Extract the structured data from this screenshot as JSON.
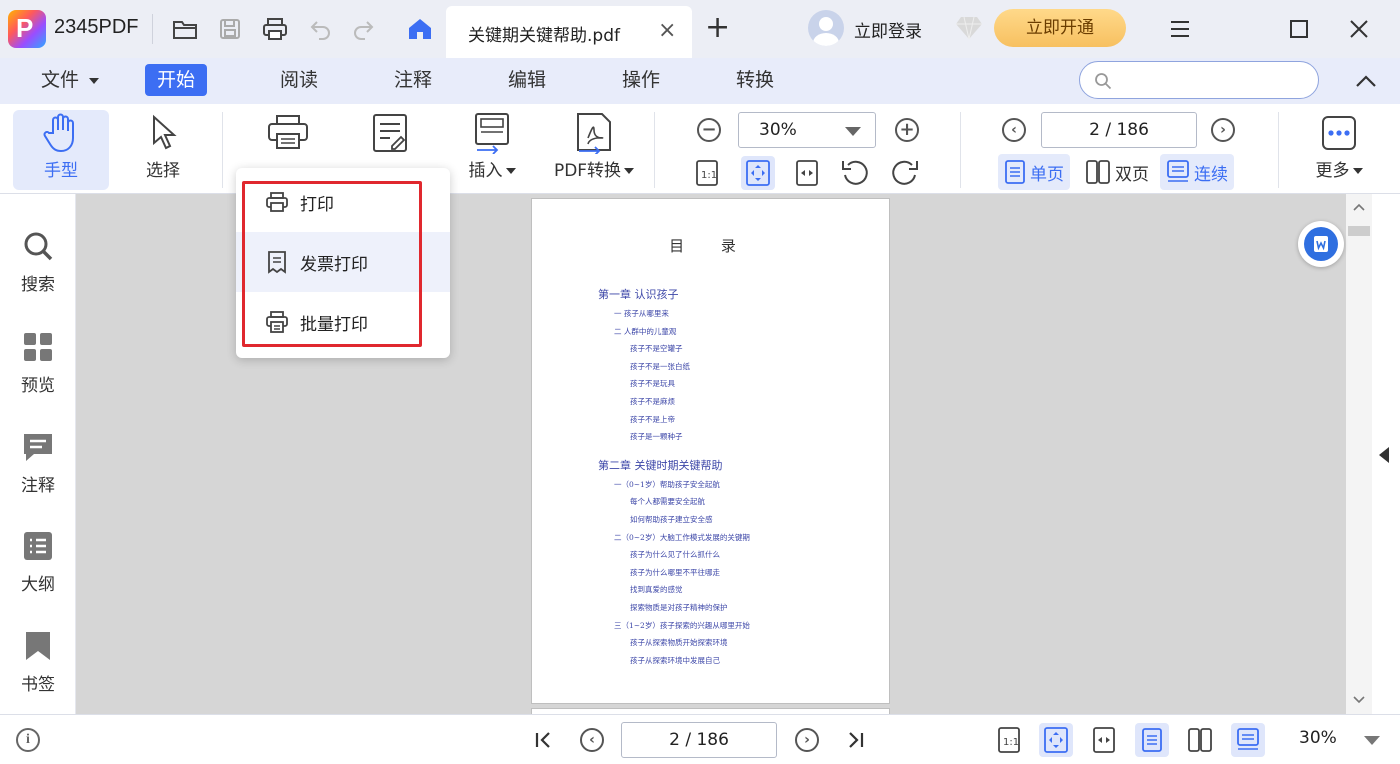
{
  "app": {
    "name": "2345PDF"
  },
  "tab": {
    "title": "关键期关键帮助.pdf",
    "close": "×",
    "add": "+"
  },
  "account": {
    "login_label": "立即登录",
    "vip_label": "立即开通"
  },
  "menu": {
    "items": [
      {
        "label": "文件",
        "has_caret": true
      },
      {
        "label": "开始",
        "active": true
      },
      {
        "label": "阅读"
      },
      {
        "label": "注释"
      },
      {
        "label": "编辑"
      },
      {
        "label": "操作"
      },
      {
        "label": "转换"
      }
    ]
  },
  "toolbar": {
    "hand_label": "手型",
    "select_label": "选择",
    "insert_label": "插入",
    "pdf_convert_label": "PDF转换",
    "zoom_value": "30%",
    "page_value": "2 / 186",
    "view_single": "单页",
    "view_double": "双页",
    "view_continuous": "连续",
    "more_label": "更多"
  },
  "print_menu": {
    "items": [
      {
        "label": "打印",
        "icon": "printer-icon"
      },
      {
        "label": "发票打印",
        "icon": "receipt-icon"
      },
      {
        "label": "批量打印",
        "icon": "batch-printer-icon"
      }
    ]
  },
  "sidebar": {
    "items": [
      {
        "label": "搜索",
        "icon": "search-icon"
      },
      {
        "label": "预览",
        "icon": "grid-icon"
      },
      {
        "label": "注释",
        "icon": "comment-icon"
      },
      {
        "label": "大纲",
        "icon": "outline-icon"
      },
      {
        "label": "书签",
        "icon": "bookmark-icon"
      }
    ]
  },
  "document": {
    "toc_title": "目 录",
    "toc": [
      {
        "level": "ch",
        "text": "第一章 认识孩子"
      },
      {
        "level": "l1",
        "text": "一 孩子从哪里来"
      },
      {
        "level": "l1",
        "text": "二 人群中的儿童观"
      },
      {
        "level": "l2",
        "text": "孩子不是空罐子"
      },
      {
        "level": "l2",
        "text": "孩子不是一张白纸"
      },
      {
        "level": "l2",
        "text": "孩子不是玩具"
      },
      {
        "level": "l2",
        "text": "孩子不是麻烦"
      },
      {
        "level": "l2",
        "text": "孩子不是上帝"
      },
      {
        "level": "l2",
        "text": "孩子是一颗种子"
      },
      {
        "level": "ch",
        "text": "第二章 关键时期关键帮助"
      },
      {
        "level": "l1",
        "text": "一（0~1岁）帮助孩子安全起航"
      },
      {
        "level": "l2",
        "text": "每个人都需要安全起航"
      },
      {
        "level": "l2",
        "text": "如何帮助孩子建立安全感"
      },
      {
        "level": "l1",
        "text": "二（0~2岁）大脑工作模式发展的关键期"
      },
      {
        "level": "l2",
        "text": "孩子为什么见了什么抓什么"
      },
      {
        "level": "l2",
        "text": "孩子为什么哪里不平往哪走"
      },
      {
        "level": "l2",
        "text": "找到真爱的感觉"
      },
      {
        "level": "l2",
        "text": "探索物质是对孩子精神的保护"
      },
      {
        "level": "l1",
        "text": "三（1~2岁）孩子探索的兴趣从哪里开始"
      },
      {
        "level": "l2",
        "text": "孩子从探索物质开始探索环境"
      },
      {
        "level": "l2",
        "text": "孩子从探索环境中发展自己"
      }
    ]
  },
  "statusbar": {
    "page_value": "2 / 186",
    "zoom_value": "30%",
    "info": "i"
  },
  "colors": {
    "accent": "#3c6ef3",
    "menu_bg": "#e8ecfa",
    "highlight": "#e0282e",
    "vip": "#f7c060",
    "toc_text": "#3d47a8"
  }
}
